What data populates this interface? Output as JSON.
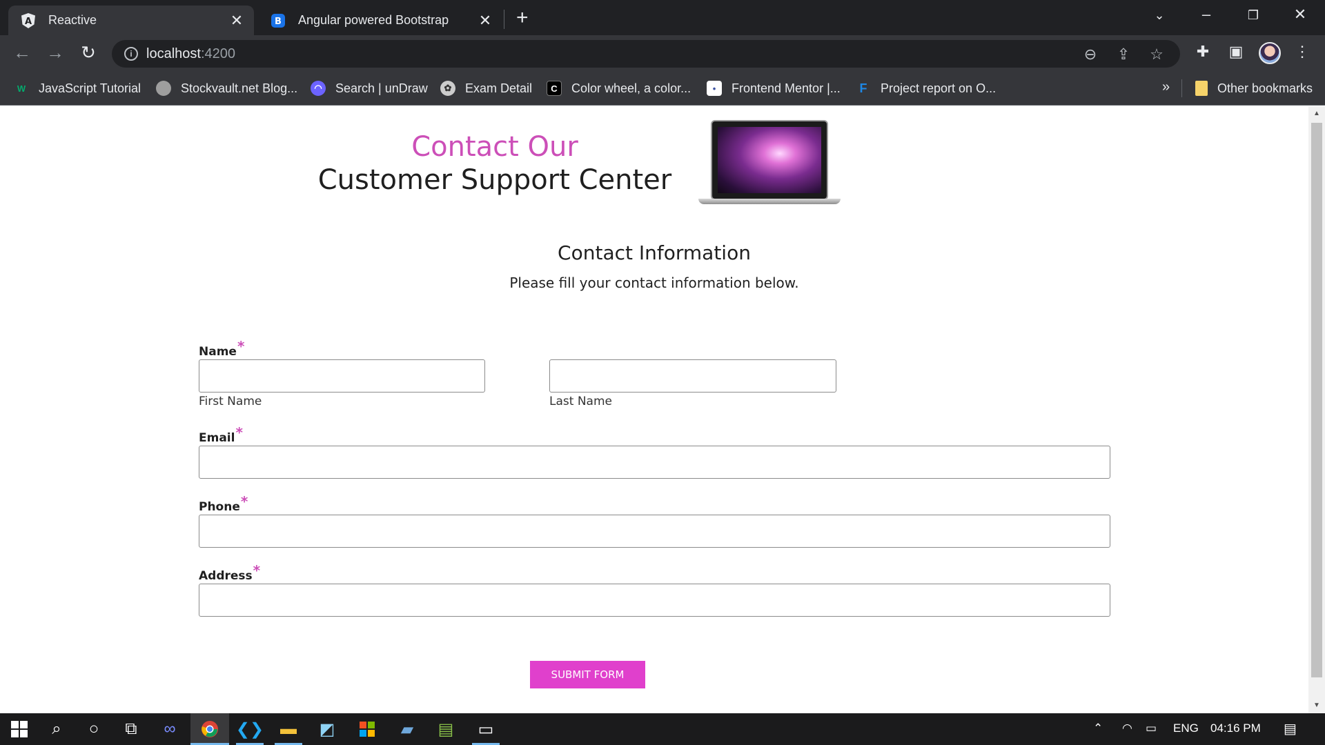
{
  "browser": {
    "tabs": [
      {
        "title": "Reactive",
        "favicon": "angular-icon",
        "active": true
      },
      {
        "title": "Angular powered Bootstrap",
        "favicon": "bootstrap-icon",
        "active": false
      }
    ],
    "url_host": "localhost",
    "url_port": ":4200",
    "bookmarks": [
      {
        "label": "JavaScript Tutorial",
        "icon": "w3schools-icon",
        "color": "#04aa6d"
      },
      {
        "label": "Stockvault.net Blog...",
        "icon": "stockvault-icon",
        "color": "#9e9e9e"
      },
      {
        "label": "Search | unDraw",
        "icon": "undraw-icon",
        "color": "#6c63ff"
      },
      {
        "label": "Exam Detail",
        "icon": "exam-icon",
        "color": "#cccccc"
      },
      {
        "label": "Color wheel, a color...",
        "icon": "color-wheel-icon",
        "color": "#000000"
      },
      {
        "label": "Frontend Mentor |...",
        "icon": "frontend-mentor-icon",
        "color": "#ffffff"
      },
      {
        "label": "Project report on O...",
        "icon": "project-icon",
        "color": "#1565c0"
      }
    ],
    "more_bookmarks": "»",
    "other_bookmarks": "Other bookmarks"
  },
  "page": {
    "heading_accent": "Contact Our",
    "heading_main": "Customer Support Center",
    "section_title": "Contact Information",
    "section_subtitle": "Please fill your contact information below.",
    "required_mark": "*",
    "name_label": "Name",
    "first_name_label": "First Name",
    "last_name_label": "Last Name",
    "email_label": "Email",
    "phone_label": "Phone",
    "address_label": "Address",
    "submit_label": "SUBMIT FORM",
    "accent_color": "#cc4fb8",
    "button_color": "#e040cc"
  },
  "taskbar": {
    "language": "ENG",
    "time": "04:16 PM"
  }
}
